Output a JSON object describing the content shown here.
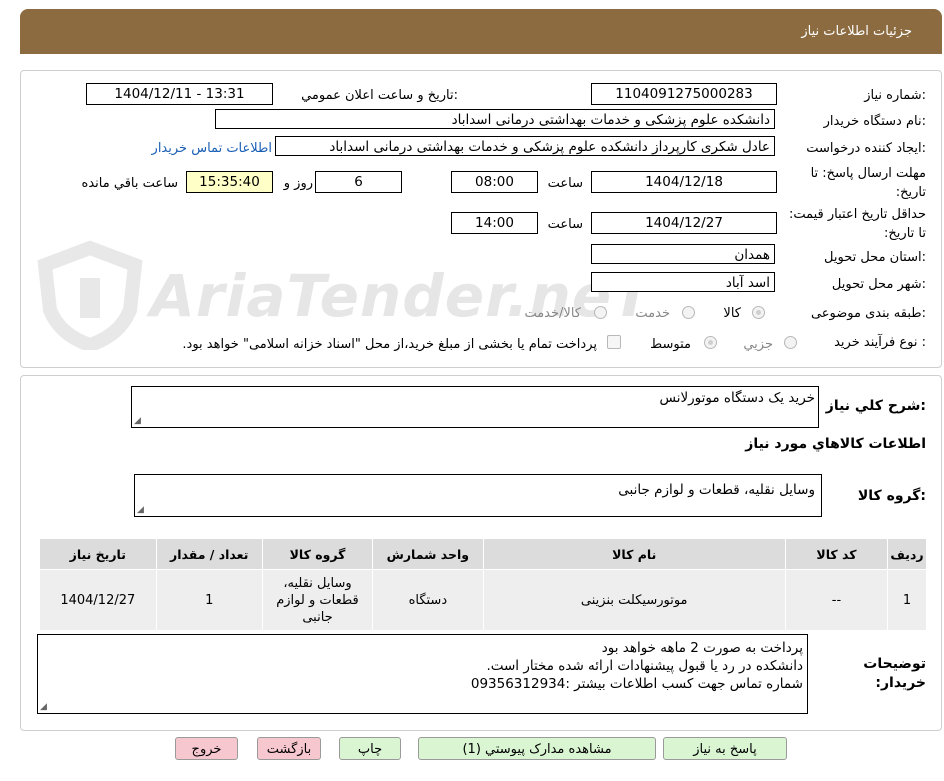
{
  "header": {
    "title": "جزئیات اطلاعات نیاز"
  },
  "watermark": {
    "text": "AriaTender.neT"
  },
  "form": {
    "need_number_label": "شماره نیاز:",
    "need_number": "1104091275000283",
    "announce_label": "تاریخ و ساعت اعلان عمومي:",
    "announce_value": "1404/12/11 - 13:31",
    "buyer_label": "نام دستگاه خريدار:",
    "buyer_value": "دانشکده علوم پزشکی و خدمات بهداشتی درمانی اسداباد",
    "requester_label": "ايجاد کننده درخواست:",
    "requester_value": "عادل شکری کارپرداز دانشکده علوم پزشکی و خدمات بهداشتی درمانی اسداباد",
    "contact_link": "اطلاعات تماس خريدار",
    "deadline_label": "مهلت ارسال پاسخ: تا تاريخ:",
    "deadline_date": "1404/12/18",
    "time_label": "ساعت",
    "deadline_time": "08:00",
    "days_value": "6",
    "days_label": "روز و",
    "remaining_time": "15:35:40",
    "remaining_label": "ساعت باقي مانده",
    "validity_label": "حداقل تاريخ اعتبار قيمت: تا تاريخ:",
    "validity_date": "1404/12/27",
    "validity_time": "14:00",
    "province_label": "استان محل تحويل:",
    "province_value": "همدان",
    "city_label": "شهر محل تحويل:",
    "city_value": "اسد آباد",
    "category_label": "طبقه بندی موضوعی:",
    "category_options": [
      "کالا",
      "خدمت",
      "کالا/خدمت"
    ],
    "category_selected": "کالا",
    "process_label": "نوع فرآيند خريد :",
    "process_options": [
      "جزيي",
      "متوسط"
    ],
    "process_selected": "متوسط",
    "payment_note": "پرداخت تمام يا بخشی از مبلغ خريد،از محل \"اسناد خزانه اسلامی\" خواهد بود."
  },
  "details": {
    "summary_label": "شرح کلي نياز:",
    "summary_value": "خرید یک دستگاه موتورلانس",
    "goods_info_title": "اطلاعات کالاهاي مورد نياز",
    "goods_group_label": "گروه کالا:",
    "goods_group_value": "وسایل نقلیه، قطعات و لوازم جانبی",
    "table": {
      "headers": [
        "رديف",
        "کد کالا",
        "نام کالا",
        "واحد شمارش",
        "گروه کالا",
        "تعداد / مقدار",
        "تاريخ نياز"
      ],
      "rows": [
        [
          "1",
          "--",
          "موتورسیکلت بنزینی",
          "دستگاه",
          "وسایل نقلیه، قطعات و لوازم جانبی",
          "1",
          "1404/12/27"
        ]
      ]
    },
    "buyer_notes_label": "توضيحات خريدار:",
    "buyer_notes": [
      "پرداخت به صورت 2 ماهه خواهد بود",
      "دانشکده در رد یا قبول پیشنهادات ارائه شده مختار است.",
      "شماره تماس جهت کسب اطلاعات بیشتر :09356312934"
    ]
  },
  "buttons": {
    "reply": "پاسخ به نياز",
    "view_docs": "مشاهده مدارک پيوستي (1)",
    "print": "چاپ",
    "back": "بازگشت",
    "exit": "خروج"
  }
}
